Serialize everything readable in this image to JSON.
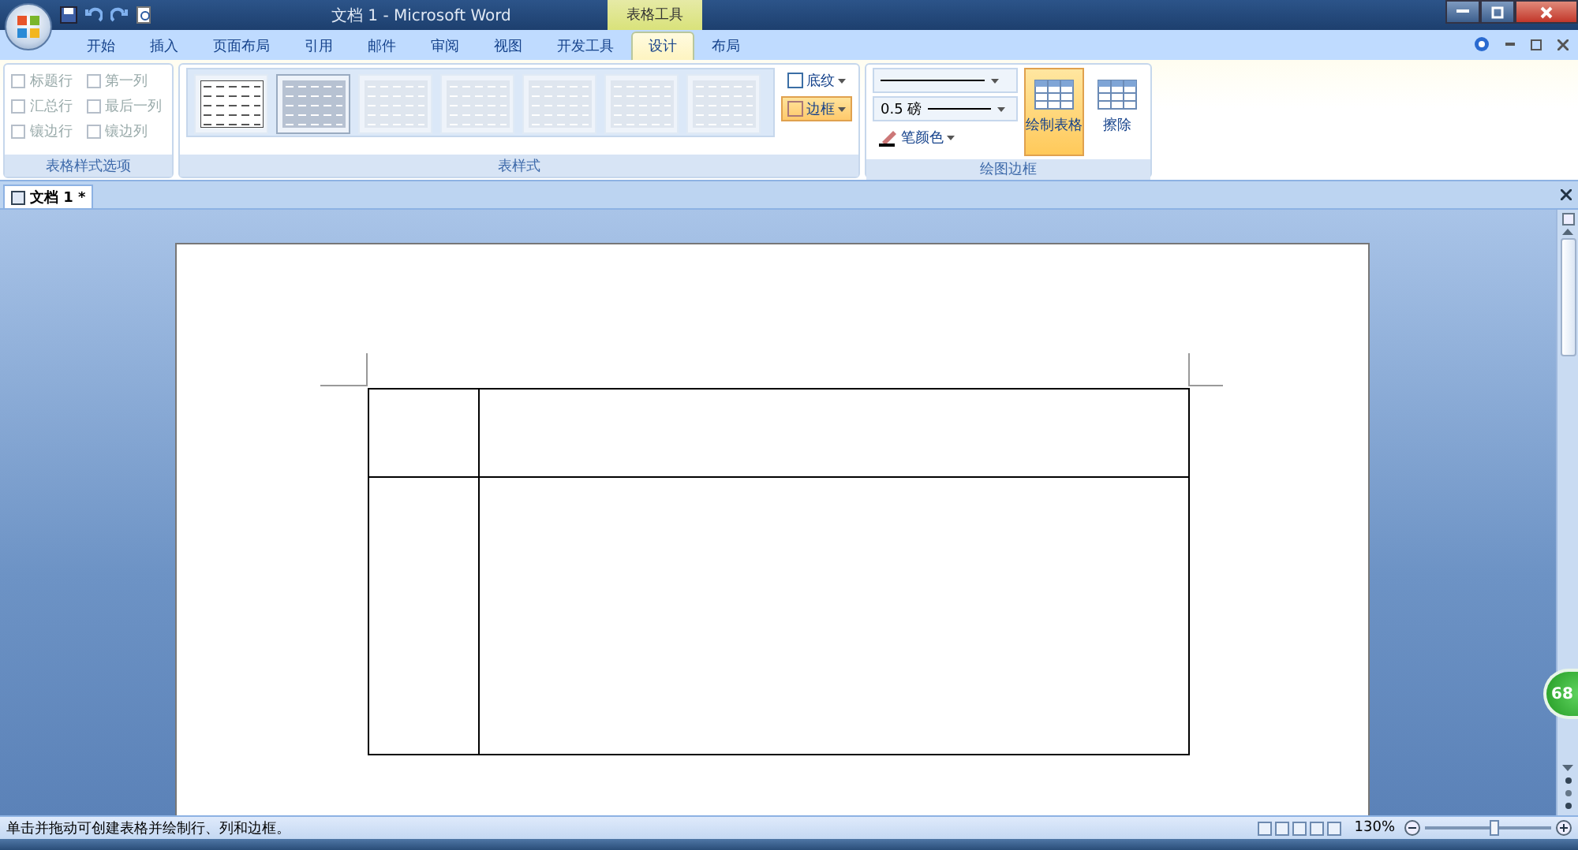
{
  "window": {
    "title": "文档 1 - Microsoft Word",
    "context_group": "表格工具"
  },
  "tabs": [
    {
      "label": "开始",
      "selected": false
    },
    {
      "label": "插入",
      "selected": false
    },
    {
      "label": "页面布局",
      "selected": false
    },
    {
      "label": "引用",
      "selected": false
    },
    {
      "label": "邮件",
      "selected": false
    },
    {
      "label": "审阅",
      "selected": false
    },
    {
      "label": "视图",
      "selected": false
    },
    {
      "label": "开发工具",
      "selected": false
    },
    {
      "label": "设计",
      "selected": true
    },
    {
      "label": "布局",
      "selected": false
    }
  ],
  "style_options": {
    "title": "表格样式选项",
    "items": [
      {
        "label": "标题行",
        "checked": false,
        "disabled": true
      },
      {
        "label": "第一列",
        "checked": false,
        "disabled": true
      },
      {
        "label": "汇总行",
        "checked": false,
        "disabled": true
      },
      {
        "label": "最后一列",
        "checked": false,
        "disabled": true
      },
      {
        "label": "镶边行",
        "checked": false,
        "disabled": true
      },
      {
        "label": "镶边列",
        "checked": false,
        "disabled": true
      }
    ]
  },
  "table_styles": {
    "title": "表样式",
    "styles": [
      {
        "selected": false
      },
      {
        "selected": true
      },
      {
        "selected": false
      },
      {
        "selected": false
      },
      {
        "selected": false
      },
      {
        "selected": false
      },
      {
        "selected": false
      }
    ],
    "buttons": [
      {
        "label": "底纹",
        "selected": false
      },
      {
        "label": "边框",
        "selected": true
      }
    ]
  },
  "draw_borders": {
    "title": "绘图边框",
    "weight": "0.5 磅",
    "pen_color": "笔颜色",
    "tools": [
      {
        "label": "绘制表格",
        "selected": true
      },
      {
        "label": "擦除",
        "selected": false
      }
    ]
  },
  "document_tab": {
    "label": "文档 1 *"
  },
  "badge": "68",
  "status_bar": {
    "message": "单击并拖动可创建表格并绘制行、列和边框。",
    "zoom": "130%",
    "zoom_slider": {
      "level": 0.55
    }
  }
}
